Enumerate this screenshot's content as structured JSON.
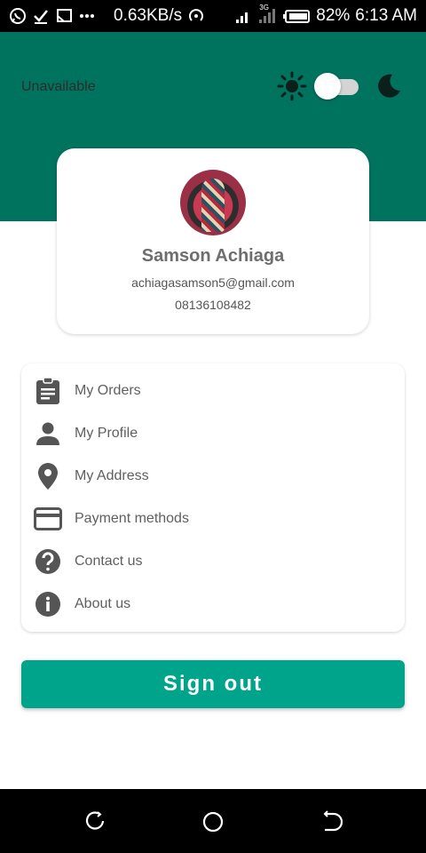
{
  "status_bar": {
    "speed": "0.63KB/s",
    "network_label": "3G",
    "battery": "82%",
    "time": "6:13 AM",
    "icons": [
      "whatsapp-icon",
      "check-icon",
      "cast-icon",
      "more-icon",
      "hotspot-icon",
      "signal-icon",
      "signal-3g-icon",
      "battery-icon"
    ]
  },
  "header": {
    "availability": "Unavailable",
    "theme_toggle": {
      "state": "off",
      "left_icon": "sun-icon",
      "right_icon": "moon-icon"
    },
    "color": "#00735f"
  },
  "profile": {
    "name": "Samson Achiaga",
    "email": "achiagasamson5@gmail.com",
    "phone": "08136108482"
  },
  "menu": {
    "items": [
      {
        "label": "My Orders",
        "icon": "clipboard-icon"
      },
      {
        "label": "My Profile",
        "icon": "person-icon"
      },
      {
        "label": "My Address",
        "icon": "location-pin-icon"
      },
      {
        "label": "Payment methods",
        "icon": "credit-card-icon"
      },
      {
        "label": "Contact us",
        "icon": "help-icon"
      },
      {
        "label": "About us",
        "icon": "info-icon"
      }
    ]
  },
  "signout": {
    "label": "Sign out",
    "color": "#00a48a"
  },
  "nav_bar": {
    "icons": [
      "recent-apps-icon",
      "home-icon",
      "back-icon"
    ]
  }
}
